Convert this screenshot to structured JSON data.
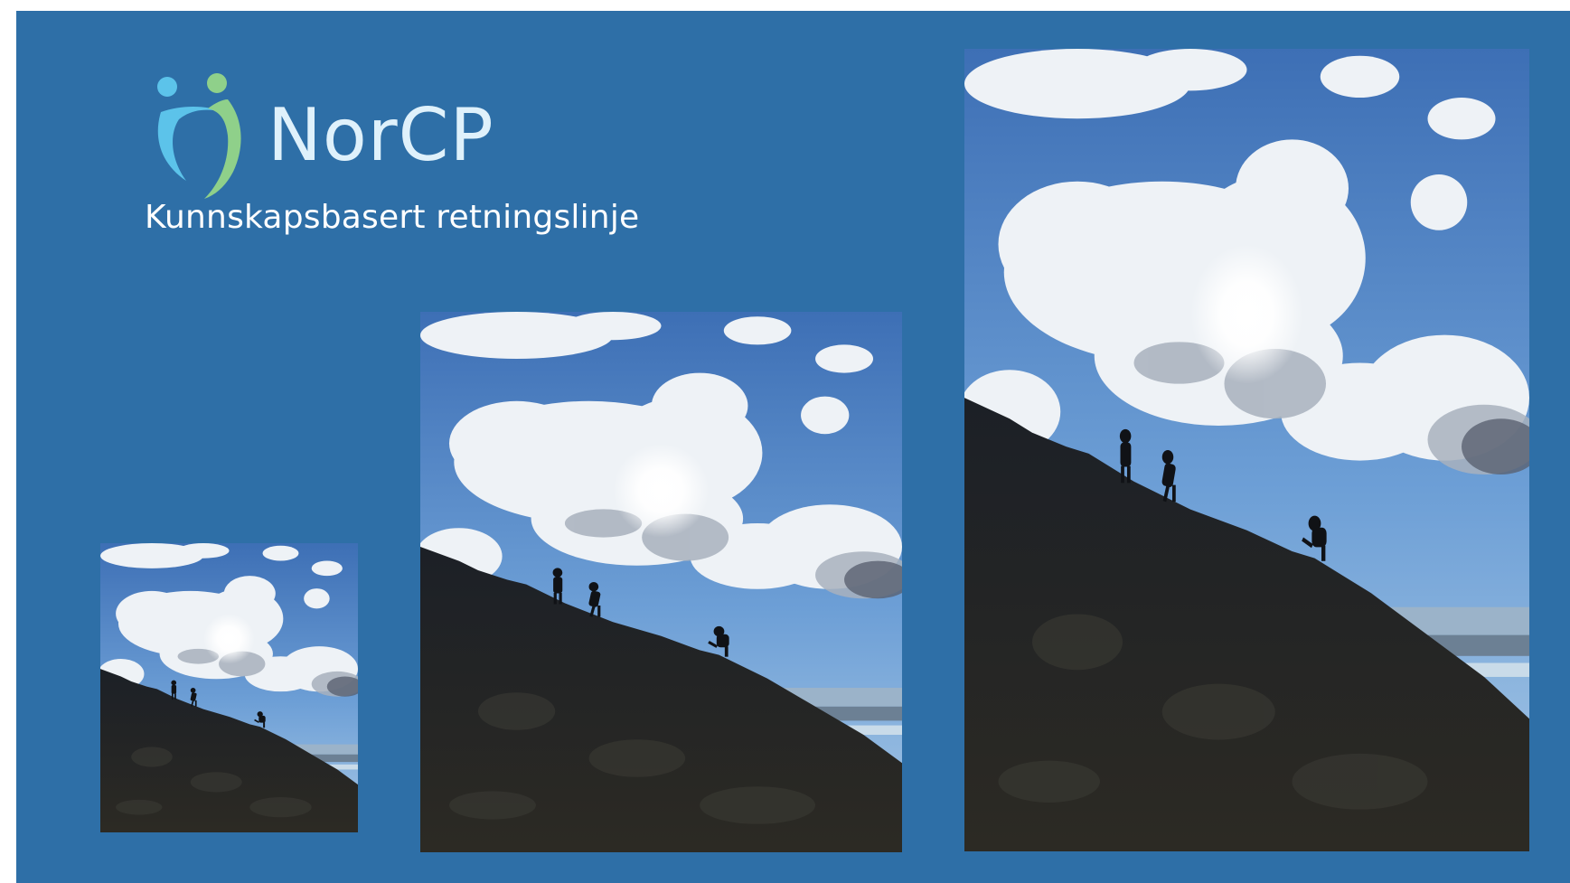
{
  "logo": {
    "name": "NorCP",
    "tagline": "Kunnskapsbasert retningslinje",
    "mark_icon": "two-figures-embrace-icon",
    "colors": {
      "figure_left": "#5cc3ea",
      "figure_right": "#8fd08a",
      "text": "#dff1fb"
    }
  },
  "background_color": "#2e6fa7",
  "photos": [
    {
      "id": "small",
      "icon": "hikers-on-mountain-photo"
    },
    {
      "id": "medium",
      "icon": "hikers-on-mountain-photo"
    },
    {
      "id": "large",
      "icon": "hikers-on-mountain-photo"
    }
  ]
}
